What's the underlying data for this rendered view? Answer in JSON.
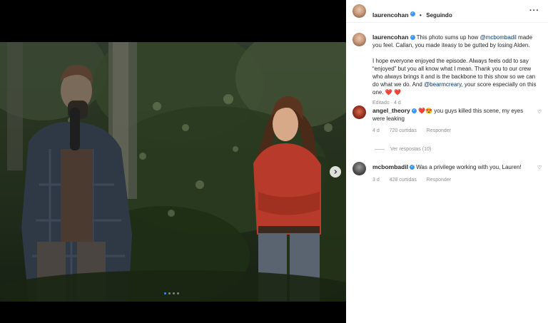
{
  "post": {
    "author": "laurencohan",
    "separator": "•",
    "follow_status": "Seguindo",
    "more_icon": "more-horizontal-icon"
  },
  "caption": {
    "username": "laurencohan",
    "p1_a": "This photo sums up how ",
    "mention1": "@mcbombadil",
    "p1_b": " made you feel. Callan, you made iteasy to be gutted by losing Alden.",
    "p2_a": "I hope everyone enjoyed the episode. Always feels odd to say “enjoyed” but you all know what I mean. Thank you to our crew who always brings it and is the backbone to this show so we can do what we do. And ",
    "mention2": "@bearmcreary",
    "p2_b": ", your score especially on this one. ",
    "hearts": "❤️ ❤️",
    "edited": "Editado",
    "edited_sep": "·",
    "edited_time": "4 d"
  },
  "comments": [
    {
      "username": "angel_theory",
      "emoji": "❤️😍",
      "text": " you guys killed this scene, my eyes were leaking",
      "time": "4 d",
      "likes": "720 curtidas",
      "reply": "Responder",
      "view_replies": "Ver respostas (10)"
    },
    {
      "username": "mcbombadil",
      "text": "Was a privilege working with you, Lauren!",
      "time": "3 d",
      "likes": "428 curtidas",
      "reply": "Responder"
    }
  ],
  "carousel": {
    "slides": 4,
    "current": 1
  },
  "colors": {
    "mention": "#00376b",
    "verified": "#3897f0",
    "dot_active": "#3a8ef6"
  }
}
